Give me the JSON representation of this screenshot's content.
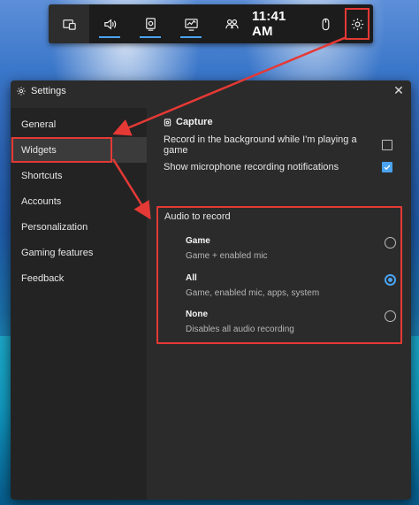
{
  "gamebar": {
    "buttons": [
      {
        "name": "widget-menu-icon",
        "underline": false
      },
      {
        "name": "audio-icon",
        "underline": true
      },
      {
        "name": "capture-icon",
        "underline": true
      },
      {
        "name": "performance-icon",
        "underline": true
      },
      {
        "name": "xbox-social-icon",
        "underline": false
      }
    ],
    "time": "11:41 AM",
    "mouse_icon": "mouse-icon",
    "settings_icon": "gear-icon"
  },
  "window": {
    "title": "Settings",
    "close_glyph": "✕"
  },
  "sidebar": {
    "items": [
      {
        "label": "General"
      },
      {
        "label": "Widgets"
      },
      {
        "label": "Shortcuts"
      },
      {
        "label": "Accounts"
      },
      {
        "label": "Personalization"
      },
      {
        "label": "Gaming features"
      },
      {
        "label": "Feedback"
      }
    ]
  },
  "content": {
    "section_title": "Capture",
    "record_background": {
      "label": "Record in the background while I'm playing a game",
      "checked": false
    },
    "mic_notifications": {
      "label": "Show microphone recording notifications",
      "checked": true
    },
    "audio": {
      "label": "Audio to record",
      "options": [
        {
          "title": "Game",
          "desc": "Game + enabled mic",
          "selected": false
        },
        {
          "title": "All",
          "desc": "Game, enabled mic, apps, system",
          "selected": true
        },
        {
          "title": "None",
          "desc": "Disables all audio recording",
          "selected": false
        }
      ]
    }
  },
  "colors": {
    "accent": "#4aa3f0",
    "highlight": "#e53935",
    "window_bg": "#2b2b2b",
    "sidebar_bg": "#232323"
  }
}
